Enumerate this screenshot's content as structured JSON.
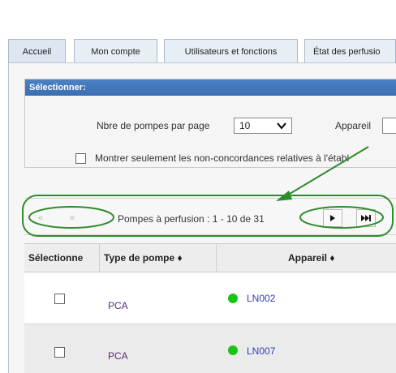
{
  "tabs": [
    {
      "label": "Accueil"
    },
    {
      "label": "Mon compte"
    },
    {
      "label": "Utilisateurs et fonctions"
    },
    {
      "label": "État des perfusio"
    }
  ],
  "select_panel": {
    "header": "Sélectionner:",
    "per_page_label": "Nbre de pompes par page",
    "per_page_value": "10",
    "appareil_label": "Appareil",
    "checkbox_label": "Montrer seulement les non-concordances relatives à l'établ"
  },
  "pager": {
    "first": "«",
    "prev": "«",
    "summary": "Pompes à perfusion : 1 - 10 de 31",
    "next": "►",
    "last": "►|"
  },
  "table": {
    "headers": [
      "Sélectionne",
      "Type de pompe ♦",
      "Appareil ♦"
    ],
    "rows": [
      {
        "type": "PCA",
        "device": "LN002",
        "status_color": "#19c419"
      },
      {
        "type": "PCA",
        "device": "LN007",
        "status_color": "#19c419"
      }
    ]
  },
  "colors": {
    "header_blue": "#3a6db2",
    "annotation_green": "#2e8b2e",
    "status_green": "#19c419"
  }
}
